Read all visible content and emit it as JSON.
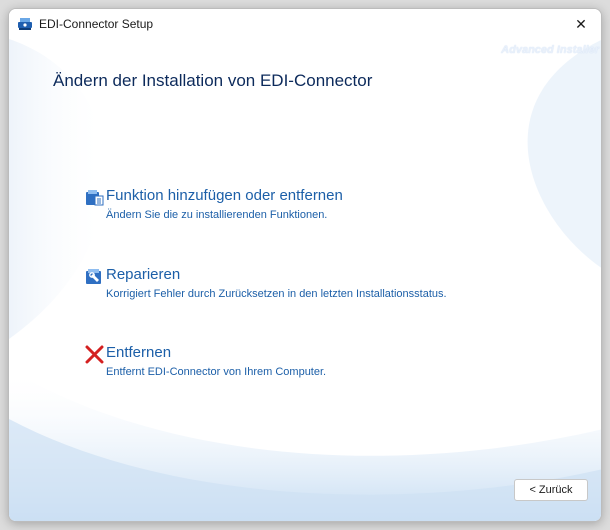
{
  "window": {
    "title": "EDI-Connector Setup",
    "close_glyph": "✕"
  },
  "brand": "Advanced Installer",
  "page_title": "Ändern der Installation von EDI-Connector",
  "options": [
    {
      "title": "Funktion hinzufügen oder entfernen",
      "description": "Ändern Sie die zu installierenden Funktionen.",
      "icon": "install-package-icon"
    },
    {
      "title": "Reparieren",
      "description": "Korrigiert Fehler durch Zurücksetzen in den letzten Installationsstatus.",
      "icon": "repair-package-icon"
    },
    {
      "title": "Entfernen",
      "description": "Entfernt EDI-Connector von Ihrem Computer.",
      "icon": "remove-x-icon"
    }
  ],
  "buttons": {
    "back_label": "< Zurück"
  },
  "colors": {
    "title": "#0c2a5b",
    "option_text": "#1c5fa8",
    "remove_icon": "#d42020"
  }
}
